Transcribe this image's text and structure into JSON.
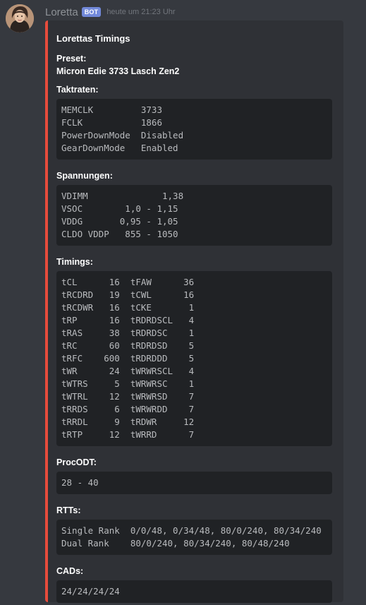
{
  "message": {
    "username": "Loretta",
    "bot_tag": "BOT",
    "timestamp": "heute um 21:23 Uhr"
  },
  "embed": {
    "color": "#e74c3c",
    "title": "Lorettas Timings",
    "preset": {
      "name": "Preset:",
      "value": "Micron Edie 3733 Lasch Zen2"
    },
    "taktraten": {
      "name": "Taktraten:",
      "lines": [
        "MEMCLK         3733",
        "FCLK           1866",
        "PowerDownMode  Disabled",
        "GearDownMode   Enabled"
      ]
    },
    "spannungen": {
      "name": "Spannungen:",
      "lines": [
        "VDIMM              1,38",
        "VSOC        1,0 - 1,15",
        "VDDG       0,95 - 1,05",
        "CLDO VDDP   855 - 1050"
      ]
    },
    "timings": {
      "name": "Timings:",
      "lines": [
        "tCL      16  tFAW      36",
        "tRCDRD   19  tCWL      16",
        "tRCDWR   16  tCKE       1",
        "tRP      16  tRDRDSCL   4",
        "tRAS     38  tRDRDSC    1",
        "tRC      60  tRDRDSD    5",
        "tRFC    600  tRDRDDD    5",
        "tWR      24  tWRWRSCL   4",
        "tWTRS     5  tWRWRSC    1",
        "tWTRL    12  tWRWRSD    7",
        "tRRDS     6  tWRWRDD    7",
        "tRRDL     9  tRDWR     12",
        "tRTP     12  tWRRD      7"
      ]
    },
    "procodt": {
      "name": "ProcODT:",
      "lines": [
        "28 - 40"
      ]
    },
    "rtts": {
      "name": "RTTs:",
      "lines": [
        "Single Rank  0/0/48, 0/34/48, 80/0/240, 80/34/240",
        "Dual Rank    80/0/240, 80/34/240, 80/48/240"
      ]
    },
    "cads": {
      "name": "CADs:",
      "lines": [
        "24/24/24/24"
      ]
    }
  }
}
